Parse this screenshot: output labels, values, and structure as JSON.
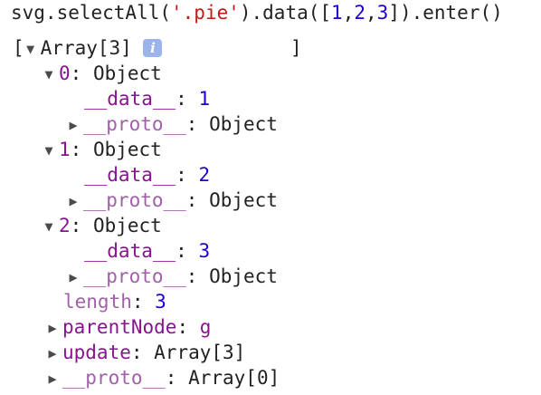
{
  "command": {
    "prefix": "svg.selectAll(",
    "selector": "'.pie'",
    "middle": ").data([",
    "values": [
      "1",
      "2",
      "3"
    ],
    "separator": ",",
    "suffix": "]).enter()"
  },
  "result": {
    "open_bracket": "[",
    "summary": "Array[3]",
    "info_icon_label": "i",
    "close_bracket": "]",
    "entries": [
      {
        "index": "0",
        "type": "Object",
        "data_key": "__data__",
        "data_value": "1",
        "proto_key": "__proto__",
        "proto_value": "Object"
      },
      {
        "index": "1",
        "type": "Object",
        "data_key": "__data__",
        "data_value": "2",
        "proto_key": "__proto__",
        "proto_value": "Object"
      },
      {
        "index": "2",
        "type": "Object",
        "data_key": "__data__",
        "data_value": "3",
        "proto_key": "__proto__",
        "proto_value": "Object"
      }
    ],
    "length_key": "length",
    "length_value": "3",
    "parent_node_key": "parentNode",
    "parent_node_value": "g",
    "update_key": "update",
    "update_value": "Array[3]",
    "proto_key": "__proto__",
    "proto_value": "Array[0]"
  },
  "icons": {
    "expanded": "triangle-down-icon",
    "collapsed": "triangle-right-icon",
    "info": "info-icon"
  },
  "colors": {
    "property_key": "#881391",
    "number": "#1c00cf",
    "string": "#c41a16",
    "text": "#222222",
    "info_badge": "#9bb5ec"
  }
}
